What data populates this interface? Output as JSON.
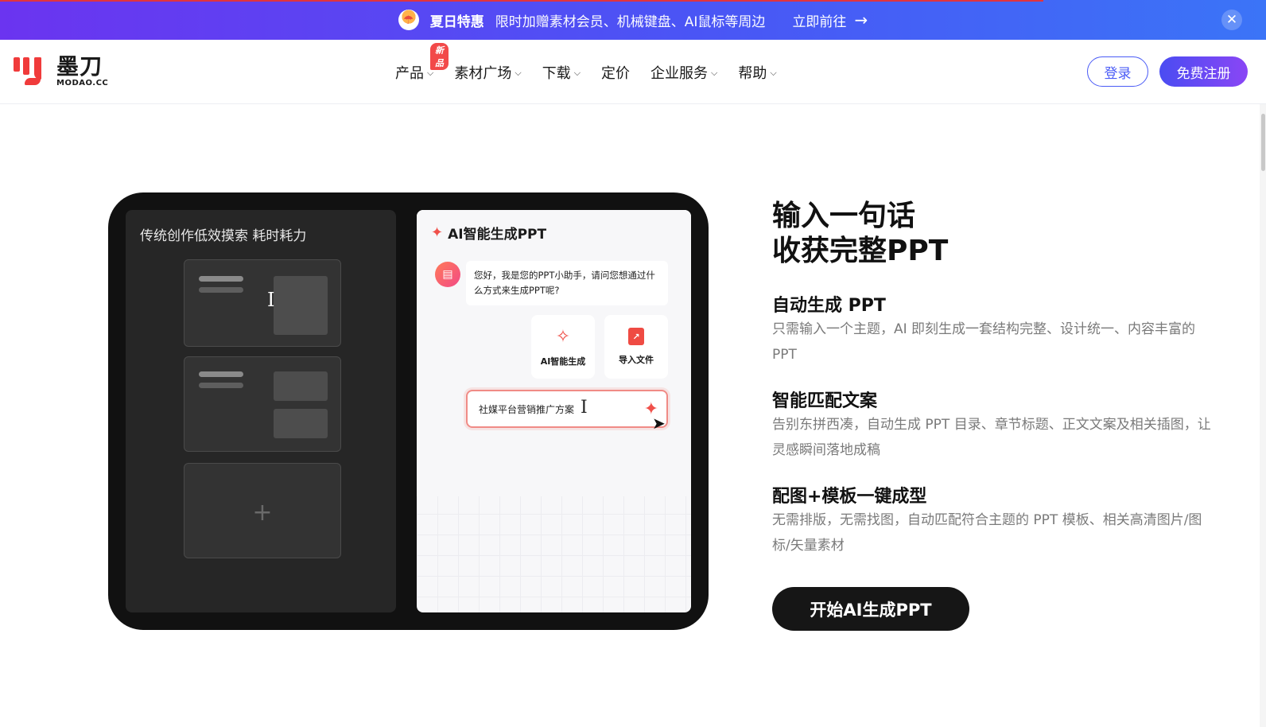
{
  "banner": {
    "title": "夏日特惠",
    "description": "限时加赠素材会员、机械键盘、AI鼠标等周边",
    "link_label": "立即前往",
    "close_label": "✕"
  },
  "logo": {
    "cn": "墨刀",
    "en": "MODAO.CC"
  },
  "nav": {
    "items": [
      {
        "label": "产品",
        "badge": "新品"
      },
      {
        "label": "素材广场"
      },
      {
        "label": "下载"
      },
      {
        "label": "定价"
      },
      {
        "label": "企业服务"
      },
      {
        "label": "帮助"
      }
    ],
    "login_label": "登录",
    "register_label": "免费注册"
  },
  "mockup": {
    "left_title": "传统创作低效摸索 耗时耗力",
    "right_title": "AI智能生成PPT",
    "bot_message": "您好，我是您的PPT小助手，请问您想通过什么方式来生成PPT呢?",
    "option_ai": "AI智能生成",
    "option_import": "导入文件",
    "input_value": "社媒平台营销推广方案"
  },
  "hero": {
    "title_line1": "输入一句话",
    "title_line2": "收获完整PPT"
  },
  "features": [
    {
      "title": "自动生成 PPT",
      "desc": "只需输入一个主题，AI 即刻生成一套结构完整、设计统一、内容丰富的 PPT"
    },
    {
      "title": "智能匹配文案",
      "desc": "告别东拼西凑，自动生成 PPT 目录、章节标题、正文文案及相关插图，让灵感瞬间落地成稿"
    },
    {
      "title": "配图+模板一键成型",
      "desc": "无需排版，无需找图，自动匹配符合主题的 PPT 模板、相关高清图片/图标/矢量素材"
    }
  ],
  "cta_label": "开始AI生成PPT",
  "colors": {
    "accent": "#4a5bf6",
    "brand_red": "#f03b3b",
    "dark": "#161616"
  }
}
